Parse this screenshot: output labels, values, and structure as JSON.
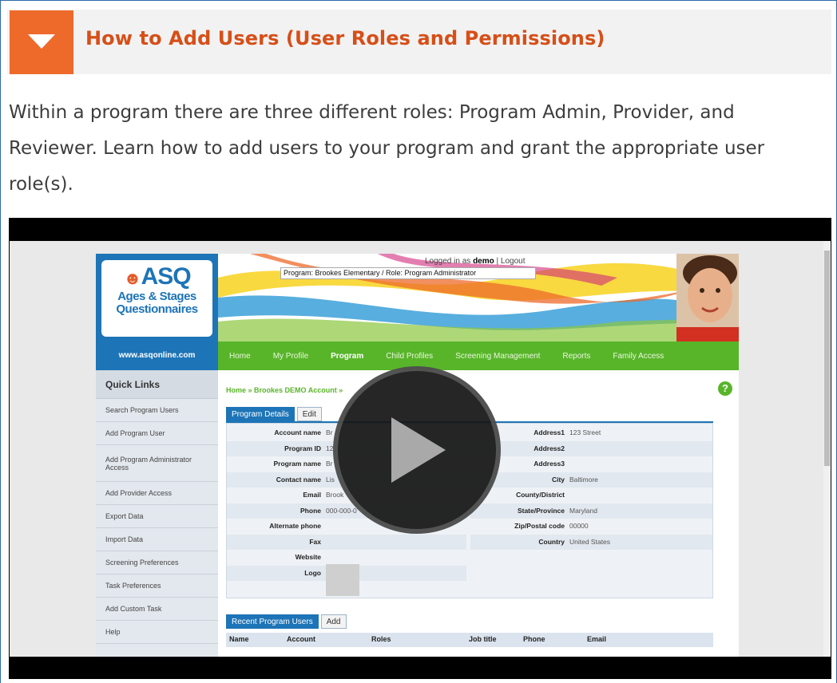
{
  "accordion": {
    "title": "How to Add Users (User Roles and Permissions)",
    "description": "Within a program there are three different roles: Program Admin, Provider, and Reviewer. Learn how to add users to your program and grant the appropriate user role(s)."
  },
  "colors": {
    "accent": "#ee6a2a",
    "title": "#d64f18",
    "site_blue": "#1d74b7",
    "site_green": "#58b52a"
  },
  "video": {
    "play_icon": "play-icon",
    "site": {
      "logo": {
        "main": "ASQ",
        "line1": "Ages & Stages",
        "line2": "Questionnaires",
        "url": "www.asqonline.com"
      },
      "login_prefix": "Logged in as",
      "login_user": "demo",
      "logout": "Logout",
      "program_select": "Program: Brookes Elementary / Role: Program Administrator",
      "nav": [
        "Home",
        "My Profile",
        "Program",
        "Child Profiles",
        "Screening Management",
        "Reports",
        "Family Access"
      ],
      "nav_active": "Program",
      "quick_links_title": "Quick Links",
      "quick_links": [
        "Search Program Users",
        "Add Program User",
        "Add Program Administrator Access",
        "Add Provider Access",
        "Export Data",
        "Import Data",
        "Screening Preferences",
        "Task Preferences",
        "Add Custom Task",
        "Help"
      ],
      "breadcrumb": "Home » Brookes DEMO Account »",
      "help_icon": "?",
      "tabs": [
        "Program Details",
        "Edit"
      ],
      "details_left": [
        {
          "label": "Account name",
          "value": "Br"
        },
        {
          "label": "Program ID",
          "value": "12"
        },
        {
          "label": "Program name",
          "value": "Br"
        },
        {
          "label": "Contact name",
          "value": "Lis"
        },
        {
          "label": "Email",
          "value": "Brook"
        },
        {
          "label": "Phone",
          "value": "000-000-0"
        },
        {
          "label": "Alternate phone",
          "value": ""
        },
        {
          "label": "Fax",
          "value": ""
        },
        {
          "label": "Website",
          "value": ""
        },
        {
          "label": "Logo",
          "value": ""
        }
      ],
      "details_right": [
        {
          "label": "Address1",
          "value": "123 Street"
        },
        {
          "label": "Address2",
          "value": ""
        },
        {
          "label": "Address3",
          "value": ""
        },
        {
          "label": "City",
          "value": "Baltimore"
        },
        {
          "label": "County/District",
          "value": ""
        },
        {
          "label": "State/Province",
          "value": "Maryland"
        },
        {
          "label": "Zip/Postal code",
          "value": "00000"
        },
        {
          "label": "Country",
          "value": "United States"
        }
      ],
      "tabs2": [
        "Recent Program Users",
        "Add"
      ],
      "users_columns": [
        "Name",
        "Account",
        "Roles",
        "Job title",
        "Phone",
        "Email"
      ]
    }
  }
}
